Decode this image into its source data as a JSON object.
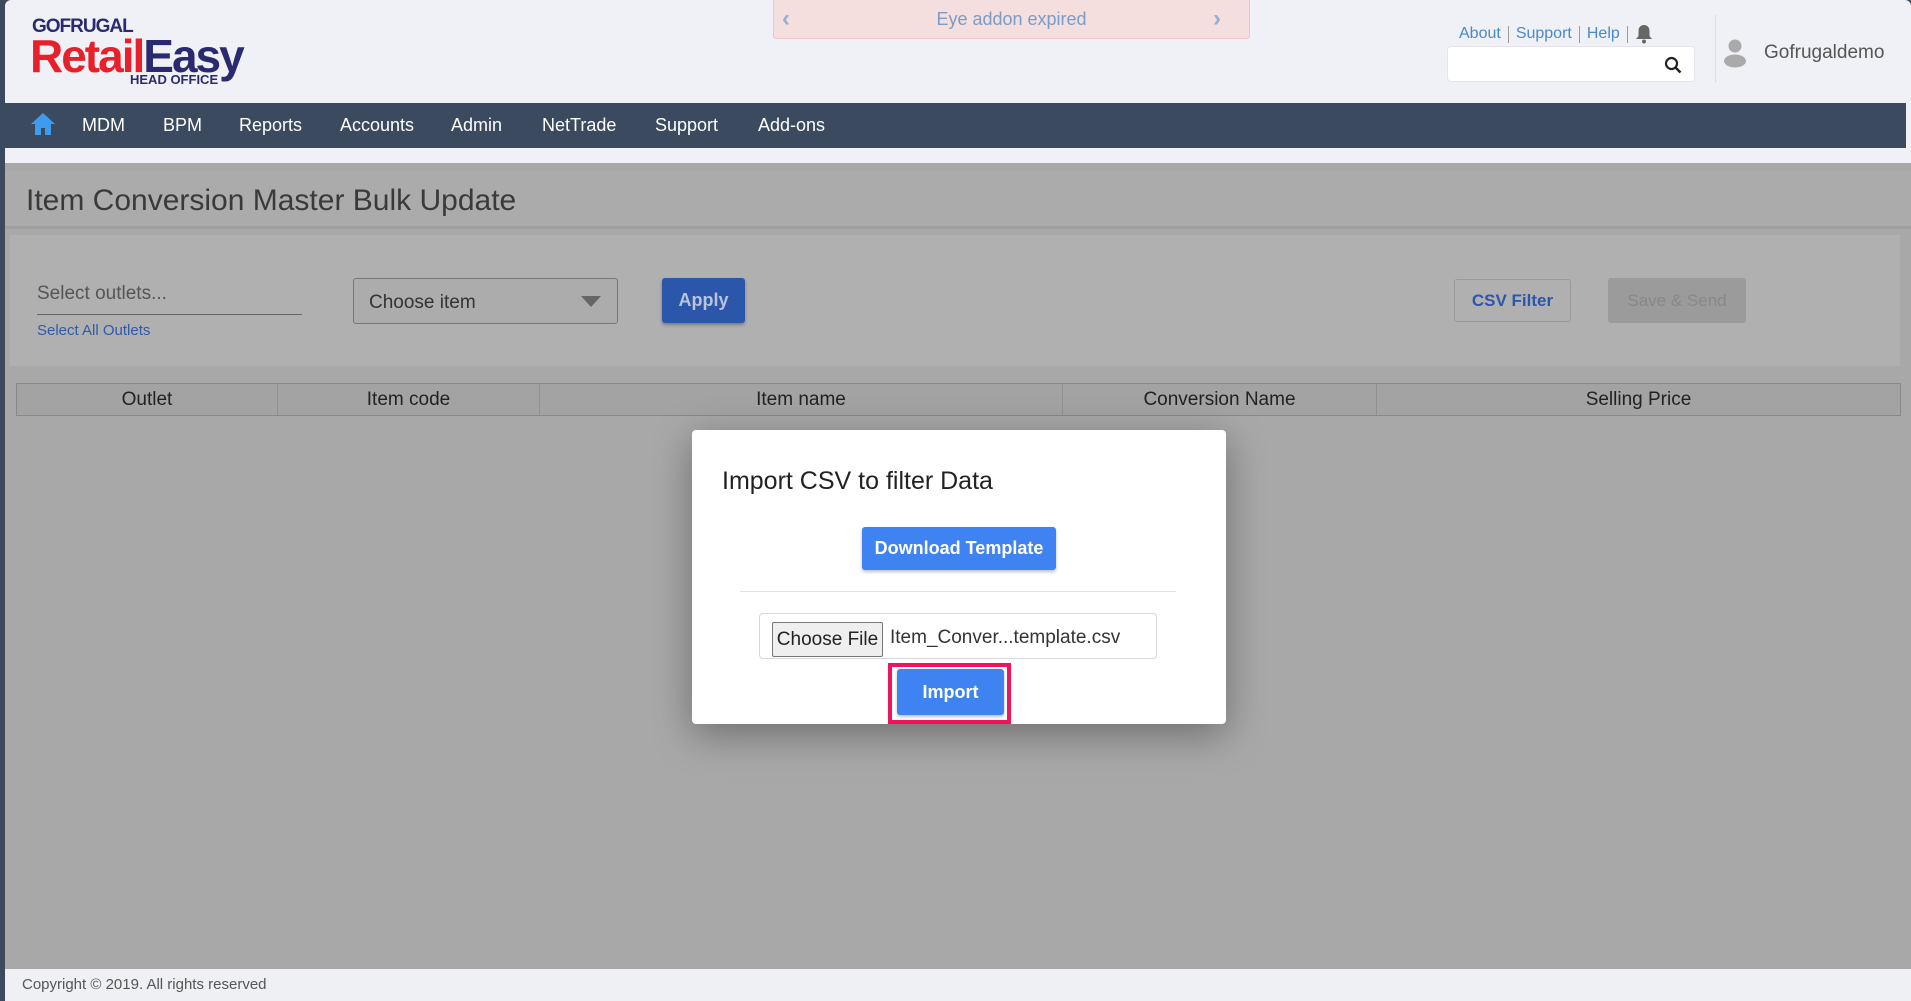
{
  "header": {
    "brand_top": "GOFRUGAL",
    "brand_retail": "Retail",
    "brand_easy": "Easy",
    "brand_sub": "HEAD OFFICE",
    "banner": {
      "text": "Eye addon expired",
      "prev_icon": "chevron-left-icon",
      "next_icon": "chevron-right-icon"
    },
    "links": [
      "About",
      "Support",
      "Help"
    ],
    "search_placeholder": "",
    "username": "Gofrugaldemo"
  },
  "nav": {
    "items": [
      "MDM",
      "BPM",
      "Reports",
      "Accounts",
      "Admin",
      "NetTrade",
      "Support",
      "Add-ons"
    ]
  },
  "page": {
    "title": "Item Conversion Master Bulk Update",
    "filters": {
      "outlets_placeholder": "Select outlets...",
      "select_all": "Select All Outlets",
      "item_select": "Choose item",
      "apply": "Apply",
      "csv_filter": "CSV Filter",
      "save_send": "Save & Send"
    },
    "table": {
      "columns": [
        "Outlet",
        "Item code",
        "Item name",
        "Conversion Name",
        "Selling Price"
      ]
    }
  },
  "modal": {
    "title": "Import CSV to filter Data",
    "download": "Download Template",
    "choose_file": "Choose File",
    "file_name": "Item_Conver...template.csv",
    "import": "Import"
  },
  "footer": {
    "copyright": "Copyright © 2019. All rights reserved"
  },
  "colors": {
    "nav": "#3b4a5f",
    "primary": "#3f83f2",
    "highlight": "#f0145a",
    "brand_red": "#e8202a",
    "brand_navy": "#2a2a6e"
  }
}
